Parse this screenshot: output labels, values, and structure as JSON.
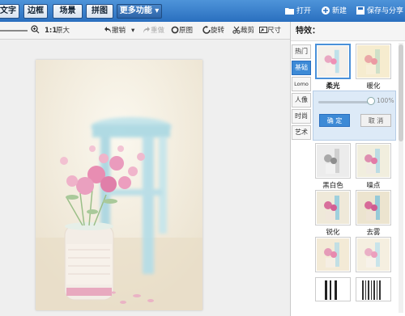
{
  "nav": {
    "tabs": [
      {
        "label": "文字"
      },
      {
        "label": "边框"
      },
      {
        "label": "场景"
      },
      {
        "label": "拼图"
      }
    ],
    "more": "更多功能 ▾",
    "open": "打开",
    "new": "新建",
    "save": "保存与分享"
  },
  "toolbar": {
    "zoom_ratio": "1:1",
    "zoom_original": "原大",
    "undo": "撤销",
    "redo": "重做",
    "original": "原图",
    "rotate": "旋转",
    "crop": "裁剪",
    "resize": "尺寸"
  },
  "panel": {
    "title": "特效：",
    "tabs": [
      "热门",
      "基础",
      "Lomo",
      "人像",
      "时尚",
      "艺术"
    ],
    "active_tab": "基础",
    "effects": [
      {
        "label": "柔光"
      },
      {
        "label": "暖化"
      },
      {
        "label": "黑白色"
      },
      {
        "label": "噪点"
      },
      {
        "label": "锐化"
      },
      {
        "label": "去雾"
      }
    ],
    "strength": "100%",
    "strength_value": 1.0,
    "ok": "确 定",
    "cancel": "取 消"
  },
  "colors": {
    "accent": "#3d8ad6",
    "topbar": "#2a6fbf"
  }
}
